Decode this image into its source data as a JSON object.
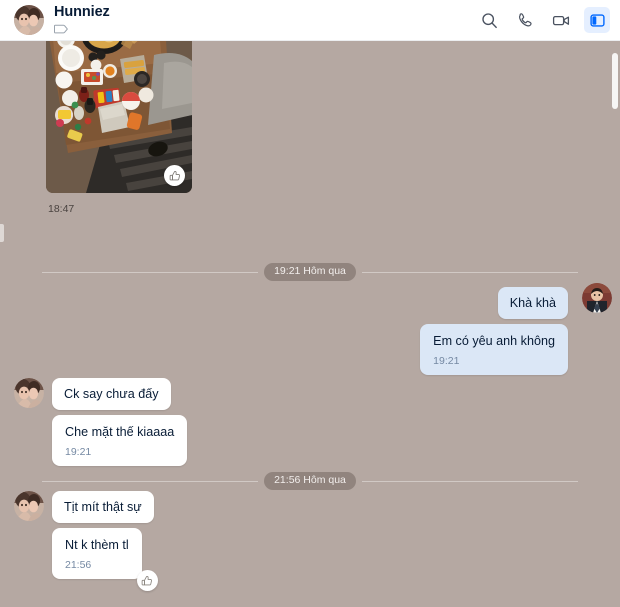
{
  "header": {
    "chat_name": "Hunniez",
    "avatar_name": "contact-avatar",
    "tag_icon": "tag-icon",
    "actions": [
      {
        "name": "search-icon",
        "label": "Search"
      },
      {
        "name": "phone-call-icon",
        "label": "Call"
      },
      {
        "name": "video-call-icon",
        "label": "Video call"
      },
      {
        "name": "conversation-info-panel-icon",
        "label": "Conversation info",
        "active": true
      }
    ],
    "accent_color": "#0068ff",
    "active_bg_color": "#e5efff"
  },
  "conversation": {
    "background_color": "#b5a8a2",
    "incoming_bubble_color": "#ffffff",
    "outgoing_bubble_color": "#dbe7f6",
    "items": [
      {
        "type": "photo",
        "direction": "incoming",
        "alt": "Overhead photo of a wooden table covered with dishes of food, plates, drinks and snacks",
        "time": "18:47",
        "reaction_icon": "thumbs-up-icon"
      },
      {
        "type": "divider",
        "label": "19:21 Hôm qua"
      },
      {
        "type": "message",
        "direction": "outgoing",
        "text": "Khà khà",
        "time": null,
        "avatar": "self-avatar"
      },
      {
        "type": "message",
        "direction": "outgoing",
        "text": "Em có yêu anh không",
        "time": "19:21"
      },
      {
        "type": "message",
        "direction": "incoming",
        "text": "Ck say chưa đấy",
        "time": null,
        "avatar": "contact-avatar"
      },
      {
        "type": "message",
        "direction": "incoming",
        "text": "Che mặt thế kiaaaa",
        "time": "19:21"
      },
      {
        "type": "divider",
        "label": "21:56 Hôm qua"
      },
      {
        "type": "message",
        "direction": "incoming",
        "text": "Tịt mít thật sự",
        "time": null,
        "avatar": "contact-avatar"
      },
      {
        "type": "message",
        "direction": "incoming",
        "text": "Nt k thèm tl",
        "time": "21:56",
        "reaction_icon": "thumbs-up-icon"
      }
    ]
  },
  "scrollbar": {
    "name": "messages-scrollbar",
    "thumb_name": "messages-scrollbar-thumb"
  }
}
